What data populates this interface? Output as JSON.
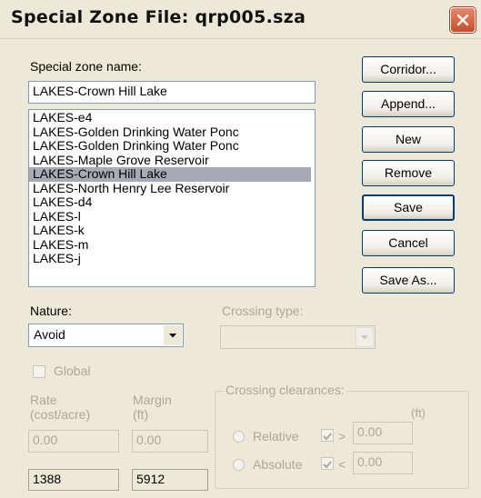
{
  "window": {
    "title": "Special Zone File:  qrp005.sza"
  },
  "zone_name": {
    "label": "Special zone name:",
    "value": "LAKES-Crown Hill Lake"
  },
  "zone_list": {
    "items": [
      "LAKES-e4",
      "LAKES-Golden Drinking Water Ponc",
      "LAKES-Golden Drinking Water Ponc",
      "LAKES-Maple Grove Reservoir",
      "LAKES-Crown Hill Lake",
      "LAKES-North Henry Lee Reservoir",
      "LAKES-d4",
      "LAKES-l",
      "LAKES-k",
      "LAKES-m",
      "LAKES-j"
    ],
    "selected": "LAKES-Crown Hill Lake"
  },
  "buttons": {
    "corridor": "Corridor...",
    "append": "Append...",
    "new": "New",
    "remove": "Remove",
    "save": "Save",
    "cancel": "Cancel",
    "save_as": "Save As..."
  },
  "nature": {
    "label": "Nature:",
    "value": "Avoid"
  },
  "crossing_type": {
    "label": "Crossing type:",
    "value": ""
  },
  "global": {
    "label": "Global",
    "checked": false
  },
  "rate": {
    "label_line1": "Rate",
    "label_line2": "(cost/acre)",
    "value": "0.00",
    "count": "1388"
  },
  "margin": {
    "label_line1": "Margin",
    "label_line2": "(ft)",
    "value": "0.00",
    "count": "5912"
  },
  "crossing_clearances": {
    "title": "Crossing clearances:",
    "unit": "(ft)",
    "relative": {
      "label": "Relative",
      "op": ">",
      "value": "0.00"
    },
    "absolute": {
      "label": "Absolute",
      "op": "<",
      "value": "0.00"
    }
  },
  "colors": {
    "selection": "#a9a9b8",
    "dialog_bg": "#ece9d8",
    "close_button": "#c84b2a"
  }
}
